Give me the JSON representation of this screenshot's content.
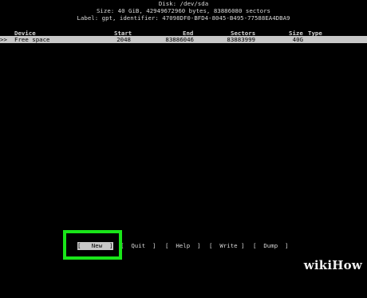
{
  "header": {
    "disk_line": "Disk: /dev/sda",
    "size_line": "Size: 40 GiB, 42949672960 bytes, 83886080 sectors",
    "label_line": "Label: gpt, identifier: 47098DF0-BFD4-8045-B495-77588EA4DBA9"
  },
  "table": {
    "columns": [
      "Device",
      "Start",
      "End",
      "Sectors",
      "Size",
      "Type"
    ],
    "rows": [
      {
        "marker": ">>",
        "device": "Free space",
        "start": "2048",
        "end": "83886046",
        "sectors": "83883999",
        "size": "40G",
        "type": ""
      }
    ]
  },
  "menu": {
    "items": [
      {
        "label": "[   New  ]",
        "selected": true
      },
      {
        "label": "[  Quit  ]",
        "selected": false
      },
      {
        "label": "[  Help  ]",
        "selected": false
      },
      {
        "label": "[  Write ]",
        "selected": false
      },
      {
        "label": "[  Dump  ]",
        "selected": false
      }
    ]
  },
  "highlight_color": "#19e619",
  "watermark": "wikiHow"
}
